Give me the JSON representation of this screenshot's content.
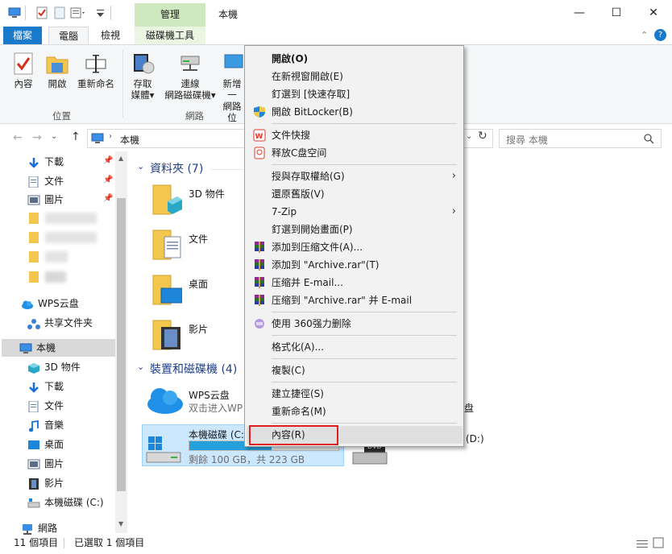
{
  "titlebar": {
    "contextual_tab_header": "管理",
    "window_title": "本機",
    "minimize": "—",
    "maximize": "☐",
    "close": "✕"
  },
  "tabs": {
    "file": "檔案",
    "computer": "電腦",
    "view": "檢視",
    "drive_tools": "磁碟機工具"
  },
  "ribbon": {
    "properties": "內容",
    "open": "開啟",
    "rename": "重新命名",
    "location_group": "位置",
    "access_media_1": "存取",
    "access_media_2": "媒體▾",
    "map_drive_1": "連線",
    "map_drive_2": "網路磁碟機▾",
    "add_location_1": "新增一",
    "add_location_2": "網路位",
    "network_group": "網路"
  },
  "nav": {
    "address_text": "本機",
    "search_placeholder": "搜尋 本機",
    "refresh": "↻"
  },
  "navpane": {
    "items": [
      {
        "label": "下載"
      },
      {
        "label": "文件"
      },
      {
        "label": "圖片"
      },
      {
        "label": "WPS云盘"
      },
      {
        "label": "共享文件夹"
      },
      {
        "label": "本機"
      },
      {
        "label": "3D 物件"
      },
      {
        "label": "下載"
      },
      {
        "label": "文件"
      },
      {
        "label": "音樂"
      },
      {
        "label": "桌面"
      },
      {
        "label": "圖片"
      },
      {
        "label": "影片"
      },
      {
        "label": "本機磁碟 (C:)"
      },
      {
        "label": "網路"
      }
    ]
  },
  "content": {
    "folders_header": "資料夾 (7)",
    "folders": [
      "3D 物件",
      "文件",
      "桌面",
      "影片"
    ],
    "drives_header": "裝置和磁碟機 (4)",
    "wps_name": "WPS云盘",
    "wps_sub": "双击进入WP",
    "c_name": "本機磁碟 (C:)",
    "c_free": "剩餘 100 GB，共 223 GB",
    "c_fill_pct": 55,
    "d_label": "(D:)",
    "right_fragment": "盘",
    "dvd": "DVD"
  },
  "status": {
    "count": "11 個項目",
    "selected": "已選取 1 個項目"
  },
  "context_menu": {
    "items": [
      {
        "label": "開啟(O)",
        "bold": true
      },
      {
        "label": "在新視窗開啟(E)"
      },
      {
        "label": "釘選到 [快速存取]"
      },
      {
        "label": "開啟 BitLocker(B)",
        "icon": "shield-icon"
      },
      {
        "label": "文件快搜",
        "icon": "wps-icon"
      },
      {
        "label": "释放C盘空间",
        "icon": "cleanup-icon"
      },
      {
        "label": "授與存取權給(G)",
        "arrow": true
      },
      {
        "label": "還原舊版(V)"
      },
      {
        "label": "7-Zip",
        "arrow": true
      },
      {
        "label": "釘選到開始畫面(P)"
      },
      {
        "label": "添加到压缩文件(A)...",
        "icon": "winrar-icon"
      },
      {
        "label": "添加到 \"Archive.rar\"(T)",
        "icon": "winrar-icon"
      },
      {
        "label": "压缩并 E-mail...",
        "icon": "winrar-icon"
      },
      {
        "label": "压缩到 \"Archive.rar\" 并 E-mail",
        "icon": "winrar-icon"
      },
      {
        "label": "使用 360强力删除",
        "icon": "360-icon"
      },
      {
        "label": "格式化(A)..."
      },
      {
        "label": "複製(C)"
      },
      {
        "label": "建立捷徑(S)"
      },
      {
        "label": "重新命名(M)"
      },
      {
        "label": "內容(R)"
      }
    ]
  },
  "colors": {
    "accent": "#1979ca",
    "drive_bar": "#26a0da",
    "highlight": "#cce8ff",
    "redbox": "#e02020"
  }
}
